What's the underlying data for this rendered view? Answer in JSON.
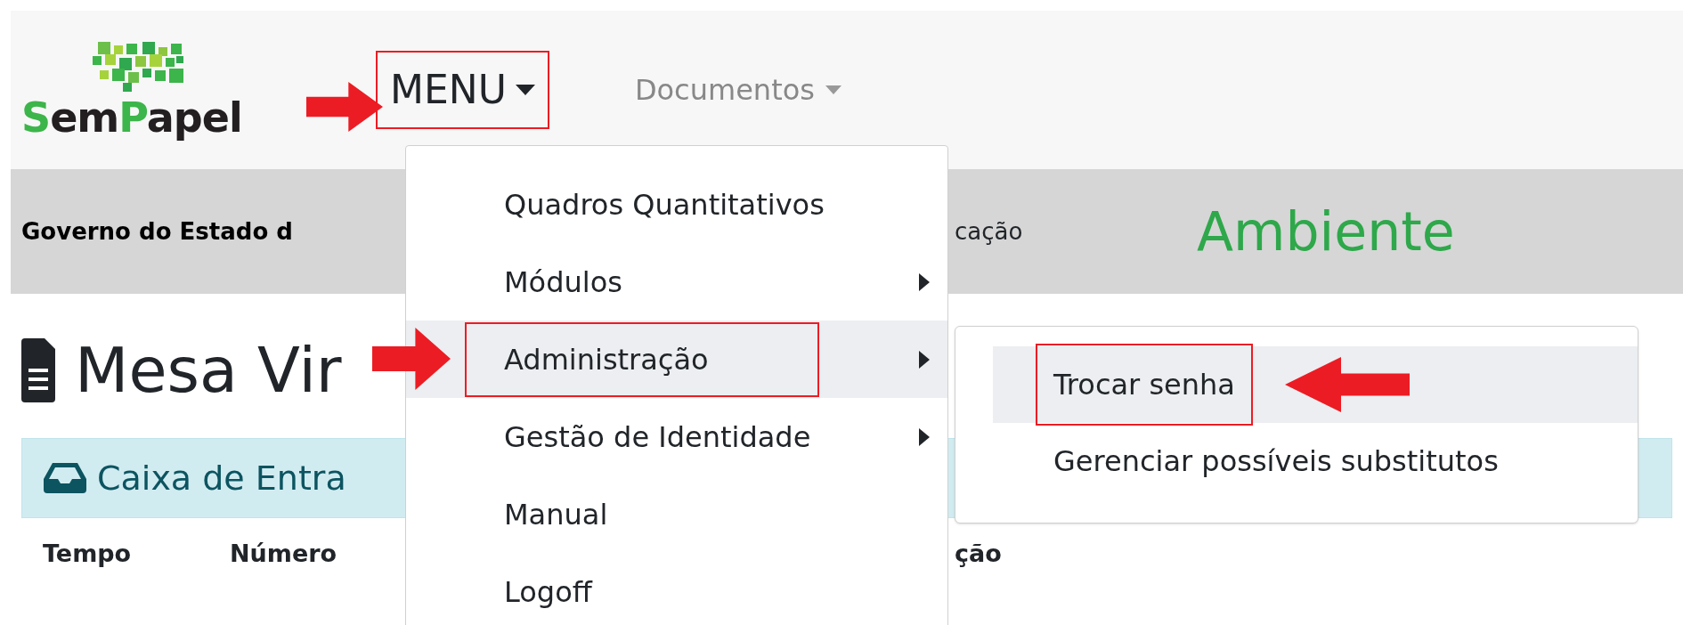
{
  "navbar": {
    "logo_parts": [
      {
        "text": "S",
        "color": "#3cb54a"
      },
      {
        "text": "em",
        "color": "#231f20"
      },
      {
        "text": "P",
        "color": "#3cb54a"
      },
      {
        "text": "apel",
        "color": "#231f20"
      }
    ],
    "menu": {
      "label": "MENU",
      "highlighted": true
    },
    "documentos": {
      "label": "Documentos"
    }
  },
  "band": {
    "org": "Governo do Estado d",
    "org_tail": "cação",
    "environment": "Ambiente"
  },
  "page": {
    "title": "Mesa Vir",
    "inbox": "Caixa de Entra",
    "columns": [
      "Tempo",
      "Número",
      "ção"
    ]
  },
  "dropdown": {
    "items": [
      {
        "label": "Quadros Quantitativos",
        "submenu": false,
        "active": false,
        "highlighted": false
      },
      {
        "label": "Módulos",
        "submenu": true,
        "active": false,
        "highlighted": false
      },
      {
        "label": "Administração",
        "submenu": true,
        "active": true,
        "highlighted": true
      },
      {
        "label": "Gestão de Identidade",
        "submenu": true,
        "active": false,
        "highlighted": false
      },
      {
        "label": "Manual",
        "submenu": false,
        "active": false,
        "highlighted": false
      },
      {
        "label": "Logoff",
        "submenu": false,
        "active": false,
        "highlighted": false
      }
    ]
  },
  "submenu": {
    "items": [
      {
        "label": "Trocar senha",
        "active": true,
        "highlighted": true
      },
      {
        "label": "Gerenciar possíveis substitutos",
        "active": false,
        "highlighted": false
      }
    ]
  }
}
